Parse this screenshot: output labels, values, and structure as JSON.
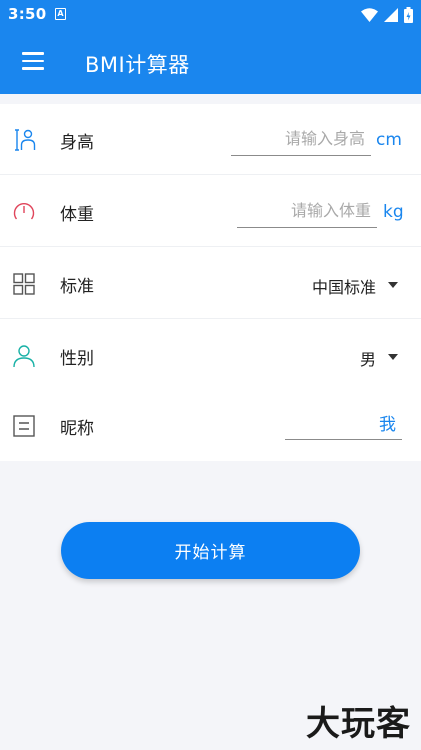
{
  "status_bar": {
    "time": "3:50",
    "notif_glyph": "A"
  },
  "app_bar": {
    "title": "BMI计算器",
    "menu_icon": "hamburger-menu-icon"
  },
  "form": {
    "height": {
      "label": "身高",
      "placeholder": "请输入身高",
      "value": "",
      "unit": "cm",
      "icon": "person-height-icon",
      "icon_color": "#1a86ee"
    },
    "weight": {
      "label": "体重",
      "placeholder": "请输入体重",
      "value": "",
      "unit": "kg",
      "icon": "gauge-icon",
      "icon_color": "#e0455b"
    },
    "standard": {
      "label": "标准",
      "value": "中国标准",
      "icon": "grid-icon"
    },
    "gender": {
      "label": "性别",
      "value": "男",
      "icon": "person-icon",
      "icon_color": "#19b1a6"
    },
    "nickname": {
      "label": "昵称",
      "value": "我",
      "icon": "note-icon"
    }
  },
  "calc_button": {
    "label": "开始计算"
  },
  "watermark": "大玩客",
  "colors": {
    "primary": "#1a86ee",
    "button": "#0c7ff2",
    "background": "#f4f5f9"
  }
}
